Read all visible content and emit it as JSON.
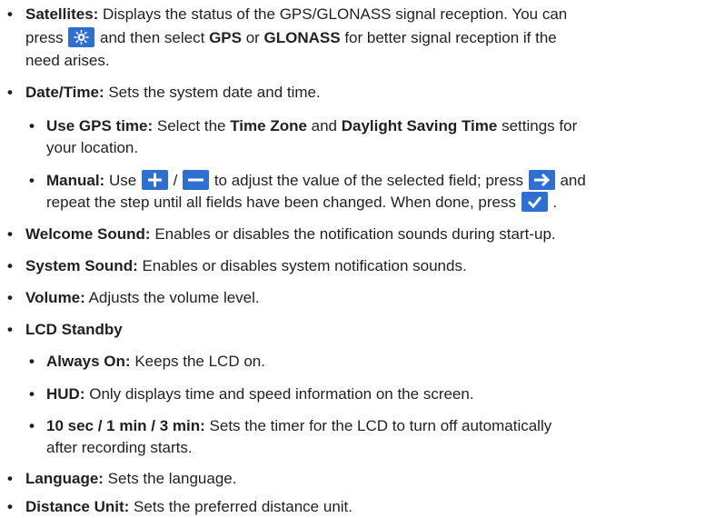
{
  "items": {
    "satellites": {
      "label": "Satellites:",
      "t1": " Displays the status of the GPS/GLONASS signal reception. You can",
      "t2a": "press ",
      "t2b": " and then select ",
      "gps": "GPS",
      "t2c": " or ",
      "glonass": "GLONASS",
      "t2d": " for better signal reception if the",
      "t3": "need arises."
    },
    "datetime": {
      "label": "Date/Time:",
      "text": " Sets the system date and time."
    },
    "use_gps_time": {
      "label": "Use GPS time:",
      "t1a": " Select the ",
      "time_zone": "Time Zone",
      "t1b": " and ",
      "dst": "Daylight Saving Time",
      "t1c": " settings for",
      "t2": "your location."
    },
    "manual": {
      "label": "Manual:",
      "t1a": " Use ",
      "slash": " / ",
      "t1b": " to adjust the value of the selected field; press ",
      "t1c": " and",
      "t2a": "repeat the step until all fields have been changed. When done, press ",
      "t2b": " ."
    },
    "welcome_sound": {
      "label": "Welcome Sound:",
      "text": " Enables or disables the notification sounds during start-up."
    },
    "system_sound": {
      "label": "System Sound:",
      "text": " Enables or disables system notification sounds."
    },
    "volume": {
      "label": "Volume:",
      "text": " Adjusts the volume level."
    },
    "lcd_standby": {
      "label": "LCD Standby"
    },
    "always_on": {
      "label": "Always On:",
      "text": " Keeps the LCD on."
    },
    "hud": {
      "label": "HUD:",
      "text": " Only displays time and speed information on the screen."
    },
    "timers": {
      "label": "10 sec / 1 min / 3 min:",
      "t1": " Sets the timer for the LCD to turn off automatically",
      "t2": "after recording starts."
    },
    "language": {
      "label": "Language:",
      "text": " Sets the language."
    },
    "distance_unit": {
      "label": "Distance Unit:",
      "text": " Sets the preferred distance unit."
    }
  },
  "bullet_char": "•",
  "icons": {
    "settings": "gear-settings-icon",
    "plus": "plus-icon",
    "minus": "minus-icon",
    "next": "arrow-right-icon",
    "confirm": "checkmark-icon"
  },
  "colors": {
    "text": "#231f20",
    "icon_bg": "#2f6fd1",
    "icon_fg": "#ffffff"
  }
}
